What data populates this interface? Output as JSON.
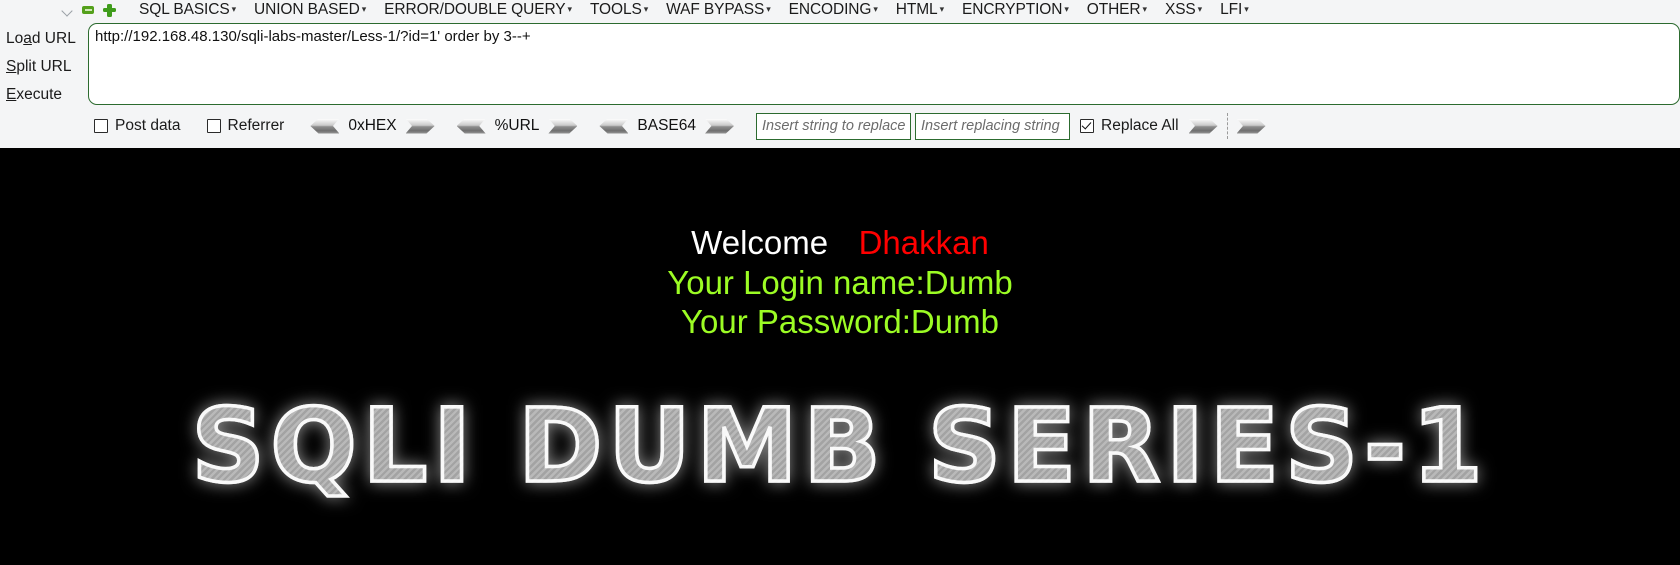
{
  "toolbar": {
    "icons": [
      {
        "name": "chevron-down-icon"
      },
      {
        "name": "minimize-icon"
      },
      {
        "name": "add-icon"
      }
    ],
    "menus": [
      {
        "label": "SQL BASICS",
        "caret": "▾"
      },
      {
        "label": "UNION BASED",
        "caret": "▾"
      },
      {
        "label": "ERROR/DOUBLE QUERY",
        "caret": "▾"
      },
      {
        "label": "TOOLS",
        "caret": "▾"
      },
      {
        "label": "WAF BYPASS",
        "caret": "▾"
      },
      {
        "label": "ENCODING",
        "caret": "▾"
      },
      {
        "label": "HTML",
        "caret": "▾"
      },
      {
        "label": "ENCRYPTION",
        "caret": "▾"
      },
      {
        "label": "OTHER",
        "caret": "▾"
      },
      {
        "label": "XSS",
        "caret": "▾"
      },
      {
        "label": "LFI",
        "caret": "▾"
      }
    ],
    "commands": [
      {
        "pre": "Lo",
        "accel": "a",
        "post": "d URL"
      },
      {
        "pre": "",
        "accel": "S",
        "post": "plit URL"
      },
      {
        "pre": "",
        "accel": "E",
        "post": "xecute"
      }
    ],
    "url_value": "http://192.168.48.130/sqli-labs-master/Less-1/?id=1' order by 3--+",
    "url_placeholder": "",
    "options": {
      "post_data": {
        "label": "Post data",
        "checked": false
      },
      "referrer": {
        "label": "Referrer",
        "checked": false
      },
      "replace_all": {
        "label": "Replace All",
        "checked": true
      }
    },
    "codecs": [
      {
        "label": "0xHEX"
      },
      {
        "label": "%URL"
      },
      {
        "label": "BASE64"
      }
    ],
    "replace": {
      "find_placeholder": "Insert string to replace",
      "find_value": "",
      "replace_placeholder": "Insert replacing string",
      "replace_value": ""
    },
    "colors": {
      "border_green": "#2c6b2f",
      "toolbar_bg": "#f4f5f6",
      "icon_green": "#3f9c1b"
    }
  },
  "page": {
    "background": "#000000",
    "welcome_label": "Welcome",
    "user_name": "Dhakkan",
    "user_color": "#ff0000",
    "login_line": "Your Login name:Dumb",
    "password_line": "Your Password:Dumb",
    "info_color": "#9cfc24",
    "logo_text": "SQLI DUMB SERIES-1"
  }
}
